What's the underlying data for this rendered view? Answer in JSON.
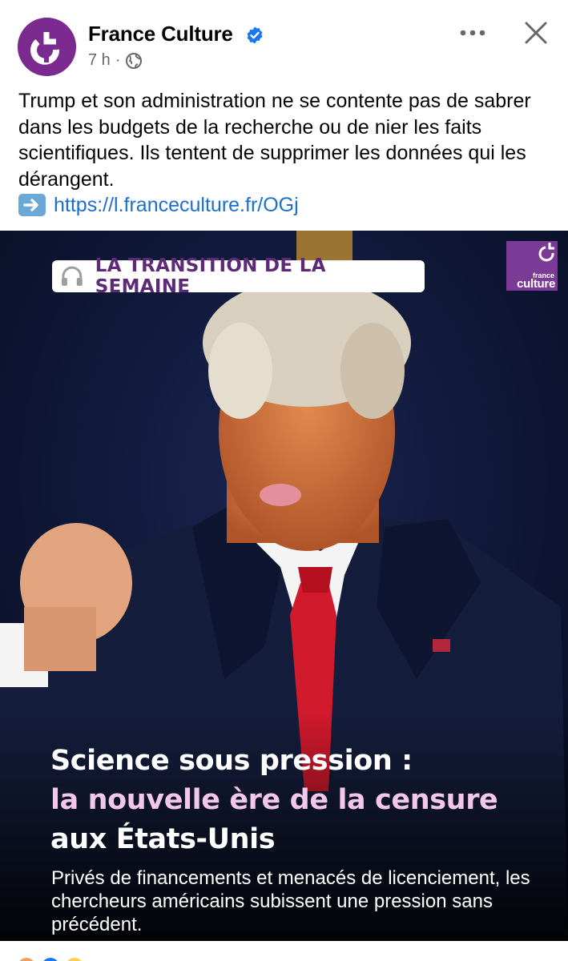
{
  "post": {
    "page_name": "France Culture",
    "time": "7 h",
    "separator": "·",
    "text": "Trump et son administration ne se contente pas de sabrer dans les budgets de la recherche ou de nier les faits scientifiques. Ils tentent de supprimer les données qui les dérangent.",
    "link": "https://l.franceculture.fr/OGj",
    "icons": {
      "verified": "verified-badge-icon",
      "audience": "globe-icon",
      "more": "more-options-icon",
      "close": "close-icon",
      "link_arrow": "right-arrow-icon"
    }
  },
  "media": {
    "tag": "LA TRANSITION DE LA SEMAINE",
    "logo_small": "france",
    "logo_big": "culture",
    "headline_line1": "Science sous pression :",
    "headline_line2": "la nouvelle ère de la censure",
    "headline_line3": "aux États-Unis",
    "subhead": "Privés de financements et menacés de licenciement, les chercheurs américains subissent une pression sans précédent."
  },
  "colors": {
    "brand_purple": "#7b2a8f",
    "link_blue": "#1a6fd1",
    "meta_gray": "#65676b",
    "headline_pink": "#f3c6ec"
  }
}
